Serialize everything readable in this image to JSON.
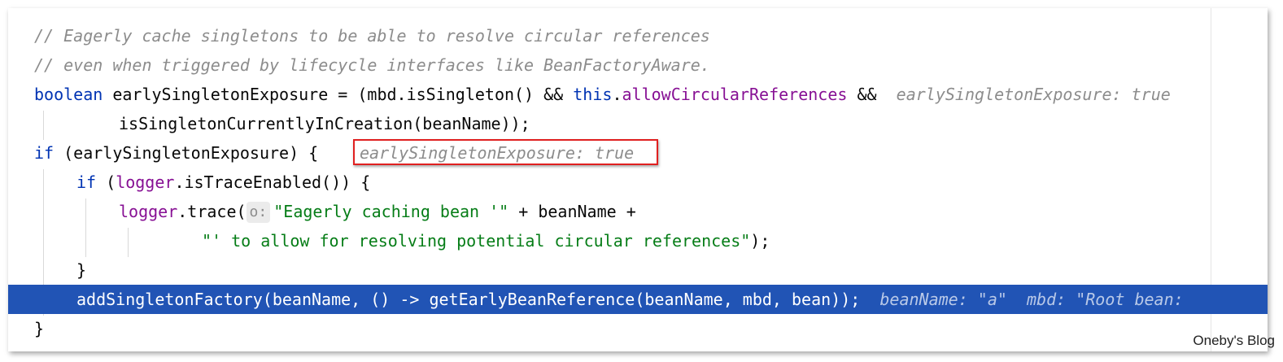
{
  "editor": {
    "lines": [
      {
        "comment": "// Eagerly cache singletons to be able to resolve circular references"
      },
      {
        "comment": "// even when triggered by lifecycle interfaces like BeanFactoryAware."
      },
      {
        "kw": "boolean",
        "code1": " earlySingletonExposure = (mbd.isSingleton() && ",
        "kw2": "this",
        "dot": ".",
        "field": "allowCircularReferences",
        "code2": " &&",
        "hint": "earlySingletonExposure: true"
      },
      {
        "code": "isSingletonCurrentlyInCreation(beanName));"
      },
      {
        "kw": "if",
        "code": " (earlySingletonExposure) {",
        "hint": "earlySingletonExposure: true"
      },
      {
        "kw": "if",
        "code1": " (",
        "field": "logger",
        "code2": ".isTraceEnabled()) {"
      },
      {
        "field": "logger",
        "code1": ".trace(",
        "param_hint": "o:",
        "str": "\"Eagerly caching bean '\"",
        "code2": " + beanName +"
      },
      {
        "str": "\"' to allow for resolving potential circular references\"",
        "code": ");"
      },
      {
        "code": "}"
      },
      {
        "code": "addSingletonFactory(beanName, () -> getEarlyBeanReference(beanName, mbd, bean));",
        "hint": "beanName: \"a\"  mbd: \"Root bean: "
      },
      {
        "code": "}"
      }
    ]
  },
  "watermark": "Oneby's Blog",
  "colors": {
    "keyword": "#0033b3",
    "field": "#871094",
    "string": "#067d17",
    "comment": "#8c8c8c",
    "execution_line": "#2154b5",
    "highlight_box": "#e02020"
  }
}
